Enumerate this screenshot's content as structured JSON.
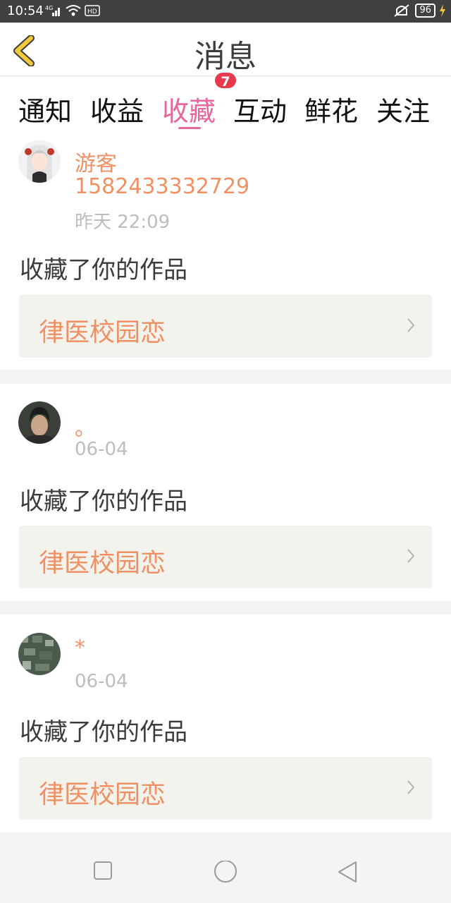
{
  "status_bar": {
    "time": "10:54",
    "battery": "96",
    "net": "4G",
    "hd": "HD"
  },
  "header": {
    "title": "消息"
  },
  "tabs": [
    {
      "label": "通知",
      "active": false
    },
    {
      "label": "收益",
      "active": false
    },
    {
      "label": "收藏",
      "active": true
    },
    {
      "label": "互动",
      "active": false
    },
    {
      "label": "鲜花",
      "active": false
    },
    {
      "label": "关注",
      "active": false
    }
  ],
  "tab_badge": "7",
  "notifications": [
    {
      "name": "游客",
      "user_id": "1582433332729",
      "time": "昨天 22:09",
      "action": "收藏了你的作品",
      "work_title": "律医校园恋"
    },
    {
      "name": "。",
      "time": "06-04",
      "action": "收藏了你的作品",
      "work_title": "律医校园恋"
    },
    {
      "name": "*",
      "time": "06-04",
      "action": "收藏了你的作品",
      "work_title": "律医校园恋"
    }
  ],
  "colors": {
    "accent": "#e8679b",
    "name": "#ef9165",
    "badge": "#e8384b",
    "back": "#f3c83c"
  },
  "icons": {
    "back": "chevron-left-icon",
    "nav": [
      "square-icon",
      "circle-icon",
      "triangle-back-icon"
    ]
  }
}
